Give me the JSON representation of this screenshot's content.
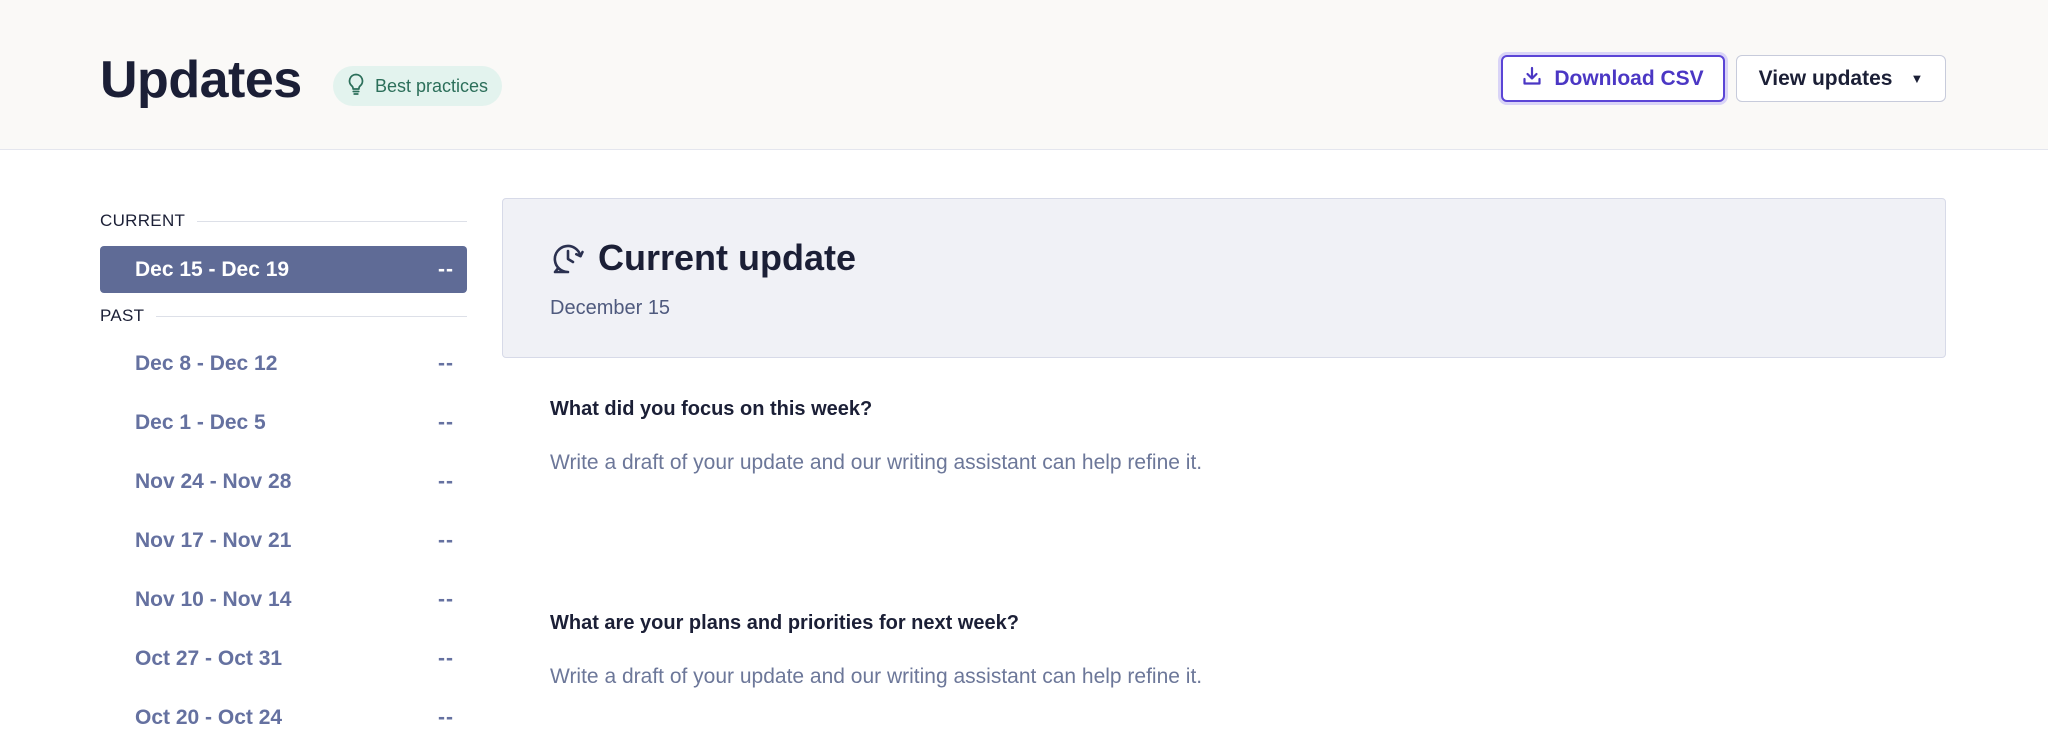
{
  "header": {
    "title": "Updates",
    "best_practices_label": "Best practices",
    "download_csv_label": "Download CSV",
    "view_updates_label": "View updates",
    "view_updates_caret": "▼"
  },
  "sidebar": {
    "current_label": "CURRENT",
    "past_label": "PAST",
    "current_week": {
      "label": "Dec 15 - Dec 19",
      "value": "--"
    },
    "past_weeks": [
      {
        "label": "Dec 8 - Dec 12",
        "value": "--"
      },
      {
        "label": "Dec 1 - Dec 5",
        "value": "--"
      },
      {
        "label": "Nov 24 - Nov 28",
        "value": "--"
      },
      {
        "label": "Nov 17 - Nov 21",
        "value": "--"
      },
      {
        "label": "Nov 10 - Nov 14",
        "value": "--"
      },
      {
        "label": "Oct 27 - Oct 31",
        "value": "--"
      },
      {
        "label": "Oct 20 - Oct 24",
        "value": "--"
      }
    ]
  },
  "main": {
    "panel_title": "Current update",
    "panel_date": "December 15",
    "questions": [
      {
        "question": "What did you focus on this week?",
        "placeholder": "Write a draft of your update and our writing assistant can help refine it."
      },
      {
        "question": "What are your plans and priorities for next week?",
        "placeholder": "Write a draft of your update and our writing assistant can help refine it."
      }
    ]
  },
  "icons": {
    "best_practices": "lightbulb-icon",
    "download": "download-icon",
    "caret": "caret-down-icon",
    "current_update": "history-chat-icon"
  },
  "colors": {
    "accent": "#4b37c4",
    "active_week_bg": "#5f6b96",
    "badge_bg": "#e3f3ee",
    "panel_bg": "#f0f1f6"
  }
}
